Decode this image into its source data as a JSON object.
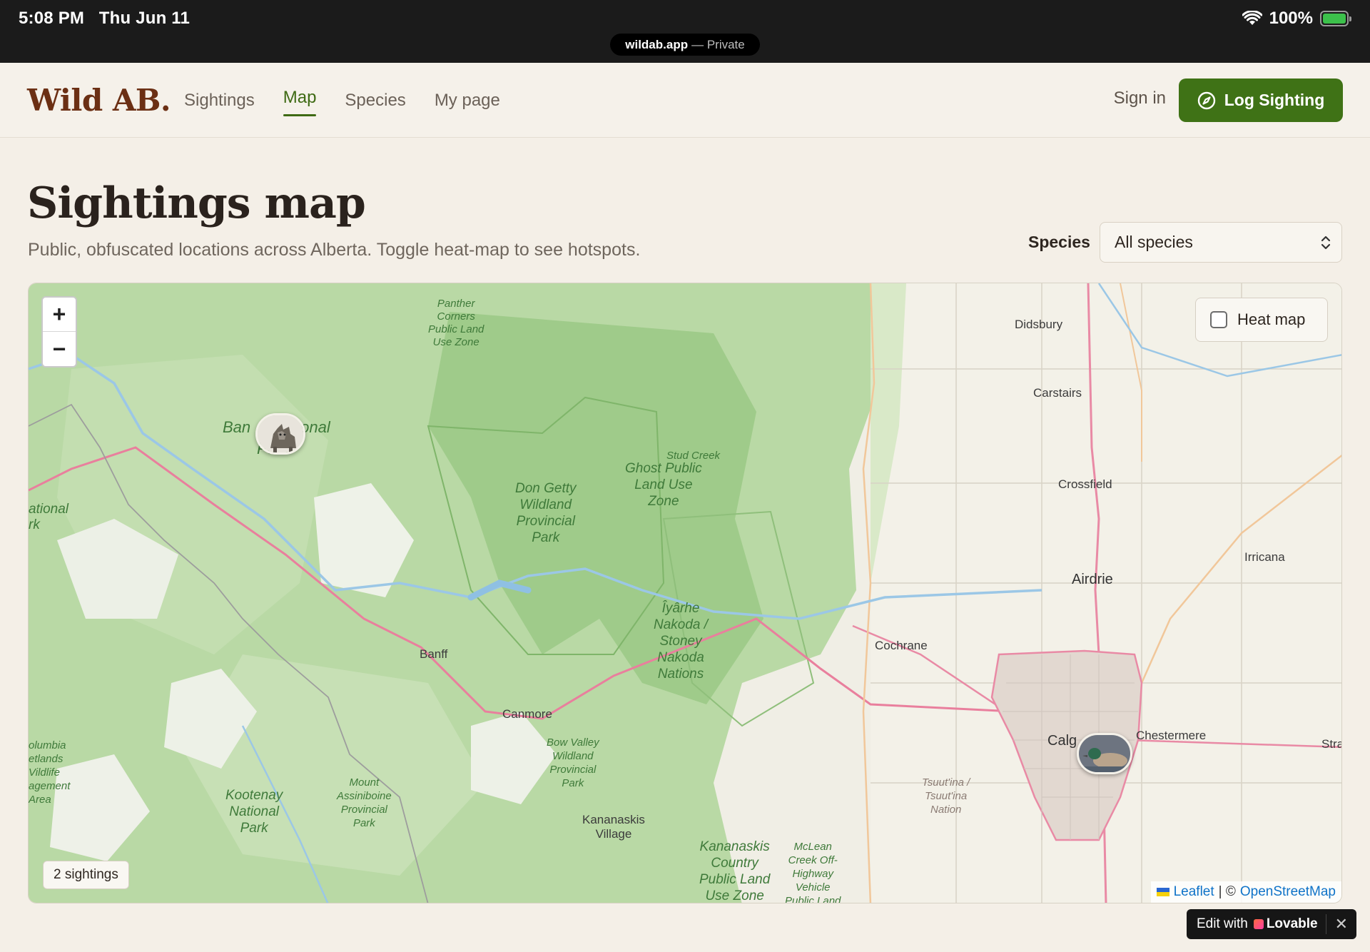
{
  "status_bar": {
    "time": "5:08 PM",
    "date": "Thu Jun 11",
    "battery": "100%",
    "battery_level": 1.0,
    "url_domain": "wildab.app",
    "url_mode": "— Private"
  },
  "header": {
    "logo": "Wild AB.",
    "nav": [
      {
        "label": "Sightings",
        "active": false
      },
      {
        "label": "Map",
        "active": true
      },
      {
        "label": "Species",
        "active": false
      },
      {
        "label": "My page",
        "active": false
      }
    ],
    "sign_in": "Sign in",
    "log_sighting": "Log Sighting"
  },
  "page": {
    "title": "Sightings map",
    "subtitle": "Public, obfuscated locations across Alberta. Toggle heat-map to see hotspots.",
    "species_label": "Species",
    "species_selected": "All species"
  },
  "map": {
    "zoom_in": "+",
    "zoom_out": "−",
    "heat_map_label": "Heat map",
    "heat_map_checked": false,
    "sightings_count": "2 sightings",
    "attribution": {
      "leaflet": "Leaflet",
      "separator": "| ©",
      "osm": "OpenStreetMap"
    },
    "places": {
      "panther": "Panther Corners Public Land Use Zone",
      "panther_l1": "Panther",
      "panther_l2": "Corners",
      "panther_l3": "Public Land",
      "panther_l4": "Use Zone",
      "banff_park_a": "Ban",
      "banff_park_b": "onal",
      "banff_park_c": "Park",
      "national_l1": "ational",
      "national_l2": "rk",
      "stud_creek": "Stud Creek",
      "ghost_l1": "Ghost Public",
      "ghost_l2": "Land Use",
      "ghost_l3": "Zone",
      "dongetty_l1": "Don Getty",
      "dongetty_l2": "Wildland",
      "dongetty_l3": "Provincial",
      "dongetty_l4": "Park",
      "iyarhe_l1": "Îyârhe",
      "iyarhe_l2": "Nakoda /",
      "iyarhe_l3": "Stoney",
      "iyarhe_l4": "Nakoda",
      "iyarhe_l5": "Nations",
      "didsbury": "Didsbury",
      "carstairs": "Carstairs",
      "crossfield": "Crossfield",
      "irricana": "Irricana",
      "airdrie": "Airdrie",
      "cochrane": "Cochrane",
      "banff": "Banff",
      "canmore": "Canmore",
      "bowvalley_l1": "Bow Valley",
      "bowvalley_l2": "Wildland",
      "bowvalley_l3": "Provincial",
      "bowvalley_l4": "Park",
      "calgary": "Calg",
      "chestermere": "Chestermere",
      "strathmore": "Stra",
      "tsuutina_l1": "Tsuut'ina /",
      "tsuutina_l2": "Tsuut'ina",
      "tsuutina_l3": "Nation",
      "kootenay_l1": "Kootenay",
      "kootenay_l2": "National",
      "kootenay_l3": "Park",
      "assiniboine_l1": "Mount",
      "assiniboine_l2": "Assiniboine",
      "assiniboine_l3": "Provincial",
      "assiniboine_l4": "Park",
      "kananaskis_l1": "Kananaskis",
      "kananaskis_l2": "Village",
      "kcountry_l1": "Kananaskis",
      "kcountry_l2": "Country",
      "kcountry_l3": "Public Land",
      "kcountry_l4": "Use Zone",
      "mclean_l1": "McLean",
      "mclean_l2": "Creek Off-",
      "mclean_l3": "Highway",
      "mclean_l4": "Vehicle",
      "mclean_l5": "Public Land",
      "columbia_l1": "olumbia",
      "columbia_l2": "etlands",
      "columbia_l3": "Vildlife",
      "columbia_l4": "agement",
      "columbia_l5": "Area"
    }
  },
  "lovable": {
    "prefix": "Edit with",
    "brand": "Lovable"
  },
  "colors": {
    "brand_green": "#3f7216",
    "logo_brown": "#6b2f14",
    "park_green": "#a8d18f"
  }
}
